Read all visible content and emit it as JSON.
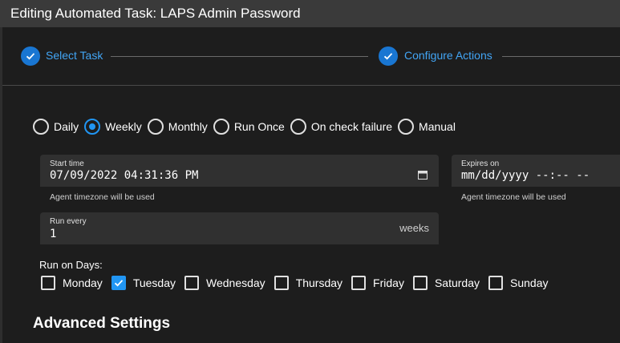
{
  "dialog": {
    "title": "Editing Automated Task: LAPS Admin Password"
  },
  "stepper": {
    "steps": [
      {
        "label": "Select Task",
        "icon": "check-icon",
        "completed": true
      },
      {
        "label": "Configure Actions",
        "icon": "check-icon",
        "completed": true
      }
    ]
  },
  "schedule": {
    "options": [
      "Daily",
      "Weekly",
      "Monthly",
      "Run Once",
      "On check failure",
      "Manual"
    ],
    "selected": "Weekly"
  },
  "start_time": {
    "label": "Start time",
    "value": "07/09/2022 04:31:36 PM",
    "hint": "Agent timezone will be used",
    "icon": "calendar-icon"
  },
  "expires_on": {
    "label": "Expires on",
    "placeholder": "mm/dd/yyyy --:-- --",
    "hint": "Agent timezone will be used"
  },
  "run_every": {
    "label": "Run every",
    "value": "1",
    "suffix": "weeks"
  },
  "run_on_days": {
    "label": "Run on Days:",
    "days": [
      {
        "label": "Monday",
        "checked": false
      },
      {
        "label": "Tuesday",
        "checked": true
      },
      {
        "label": "Wednesday",
        "checked": false
      },
      {
        "label": "Thursday",
        "checked": false
      },
      {
        "label": "Friday",
        "checked": false
      },
      {
        "label": "Saturday",
        "checked": false
      },
      {
        "label": "Sunday",
        "checked": false
      }
    ]
  },
  "advanced": {
    "title": "Advanced Settings"
  },
  "colors": {
    "accent": "#2196f3",
    "step_label": "#42a5f5",
    "background": "#1d1d1d",
    "title_bar": "#3a3a3a",
    "field_bg": "#303030"
  }
}
